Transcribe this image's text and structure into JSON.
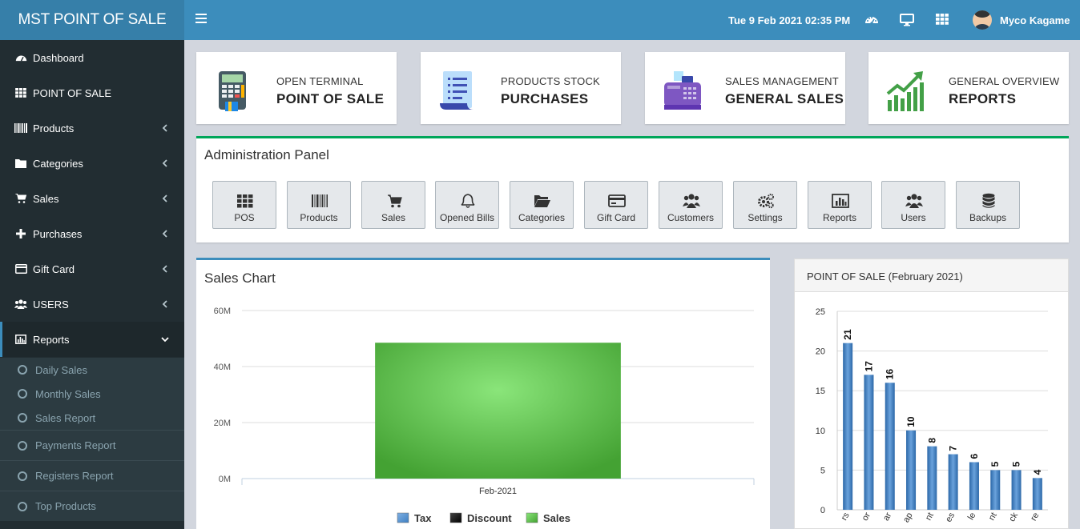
{
  "app": {
    "title": "MST POINT OF SALE"
  },
  "header": {
    "datetime": "Tue 9 Feb 2021 02:35 PM",
    "user_name": "Myco Kagame"
  },
  "sidebar": {
    "items": [
      {
        "label": "Dashboard",
        "icon": "dashboard-icon"
      },
      {
        "label": "POINT OF SALE",
        "icon": "th-icon"
      },
      {
        "label": "Products",
        "icon": "barcode-icon"
      },
      {
        "label": "Categories",
        "icon": "folder-icon"
      },
      {
        "label": "Sales",
        "icon": "cart-icon"
      },
      {
        "label": "Purchases",
        "icon": "plus-icon"
      },
      {
        "label": "Gift Card",
        "icon": "credit-card-icon"
      },
      {
        "label": "USERS",
        "icon": "users-icon"
      },
      {
        "label": "Reports",
        "icon": "bar-chart-icon"
      }
    ],
    "report_subitems": [
      "Daily Sales",
      "Monthly Sales",
      "Sales Report",
      "Payments Report",
      "Registers Report",
      "Top Products"
    ]
  },
  "cards": [
    {
      "subtitle": "OPEN TERMINAL",
      "title": "POINT OF SALE",
      "icon": "pos-terminal-icon"
    },
    {
      "subtitle": "PRODUCTS STOCK",
      "title": "PURCHASES",
      "icon": "receipt-list-icon"
    },
    {
      "subtitle": "SALES MANAGEMENT",
      "title": "GENERAL SALES",
      "icon": "cash-register-icon"
    },
    {
      "subtitle": "GENERAL OVERVIEW",
      "title": "REPORTS",
      "icon": "growth-chart-icon"
    }
  ],
  "admin_panel": {
    "title": "Administration Panel",
    "buttons": [
      {
        "label": "POS",
        "icon": "th-icon"
      },
      {
        "label": "Products",
        "icon": "barcode-icon"
      },
      {
        "label": "Sales",
        "icon": "cart-icon"
      },
      {
        "label": "Opened Bills",
        "icon": "bell-icon"
      },
      {
        "label": "Categories",
        "icon": "folder-open-icon"
      },
      {
        "label": "Gift Card",
        "icon": "credit-card-icon"
      },
      {
        "label": "Customers",
        "icon": "users-icon"
      },
      {
        "label": "Settings",
        "icon": "cogs-icon"
      },
      {
        "label": "Reports",
        "icon": "bar-chart-icon"
      },
      {
        "label": "Users",
        "icon": "users-icon"
      },
      {
        "label": "Backups",
        "icon": "database-icon"
      }
    ]
  },
  "colors": {
    "accent": "#3c8dbc",
    "sidebar": "#222d32",
    "success": "#00a65a",
    "sales_green": "#4cb848",
    "bar_blue": "#3f7fc1"
  },
  "chart_data": [
    {
      "type": "bar",
      "title": "Sales Chart",
      "categories": [
        "Feb-2021"
      ],
      "series": [
        {
          "name": "Tax",
          "values": [
            0
          ]
        },
        {
          "name": "Discount",
          "values": [
            0
          ]
        },
        {
          "name": "Sales",
          "values": [
            48500000
          ]
        }
      ],
      "y_ticks": [
        "0M",
        "20M",
        "40M",
        "60M"
      ],
      "ylim": [
        0,
        60000000
      ],
      "grid": true,
      "legend": "bottom"
    },
    {
      "type": "bar",
      "title": "POINT OF SALE (February 2021)",
      "categories": [
        "rs",
        "or",
        "ar",
        "ap",
        "nt",
        "es",
        "le",
        "nt",
        "ck",
        "re"
      ],
      "values": [
        21,
        17,
        16,
        10,
        8,
        7,
        6,
        5,
        5,
        4
      ],
      "y_ticks": [
        "0",
        "5",
        "10",
        "15",
        "20",
        "25"
      ],
      "ylim": [
        0,
        25
      ],
      "grid": true,
      "legend": "none"
    }
  ]
}
